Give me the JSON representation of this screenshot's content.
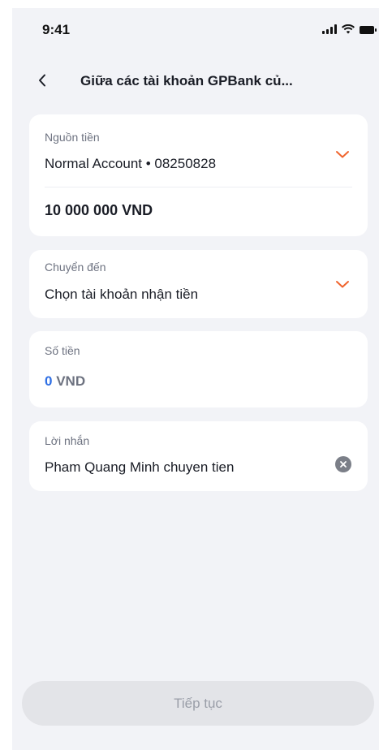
{
  "status_bar": {
    "time": "9:41"
  },
  "header": {
    "title": "Giữa các tài khoản GPBank củ..."
  },
  "source": {
    "label": "Nguồn tiền",
    "account": "Normal Account  •  08250828",
    "balance": "10 000 000 VND"
  },
  "destination": {
    "label": "Chuyển đến",
    "placeholder": "Chọn tài khoản nhận tiền"
  },
  "amount": {
    "label": "Số tiền",
    "value": "0",
    "unit": "VND"
  },
  "message": {
    "label": "Lời nhắn",
    "value": "Pham Quang Minh chuyen tien"
  },
  "footer": {
    "continue_label": "Tiếp tục"
  },
  "colors": {
    "background": "#f2f3f7",
    "accent_orange": "#f0642d",
    "amount_blue": "#2f6fe4",
    "button_disabled": "#e3e4e8"
  },
  "icons": {
    "back": "chevron-left-icon",
    "dropdown": "chevron-down-icon",
    "clear": "close-circle-icon"
  }
}
